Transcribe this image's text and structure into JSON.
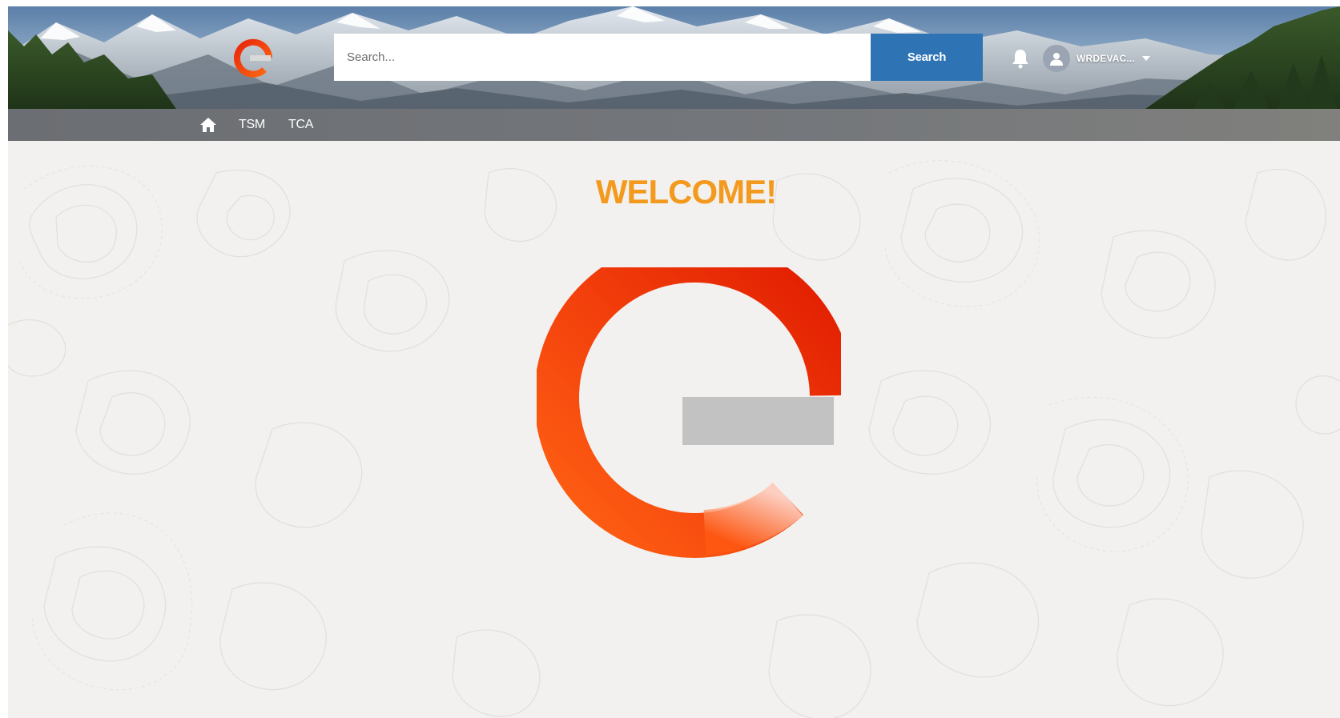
{
  "header": {
    "logo_icon": "enel-logo-icon",
    "search": {
      "placeholder": "Search...",
      "value": "",
      "button_label": "Search"
    },
    "notifications_icon": "bell-icon",
    "user": {
      "avatar_icon": "user-avatar-icon",
      "name": "WRDEVAC...",
      "menu_icon": "chevron-down-icon"
    }
  },
  "nav": {
    "home_icon": "home-icon",
    "items": [
      {
        "label": "TSM"
      },
      {
        "label": "TCA"
      }
    ]
  },
  "main": {
    "welcome_text": "WELCOME!",
    "logo_icon": "enel-logo-icon"
  },
  "colors": {
    "accent_orange": "#f39a1e",
    "search_button": "#2e74b5",
    "nav_bar": "#6e7175",
    "logo_red": "#e52d08",
    "logo_orange": "#ff5a0f",
    "logo_grey": "#c2c2c2",
    "page_background": "#f2f1ef"
  }
}
